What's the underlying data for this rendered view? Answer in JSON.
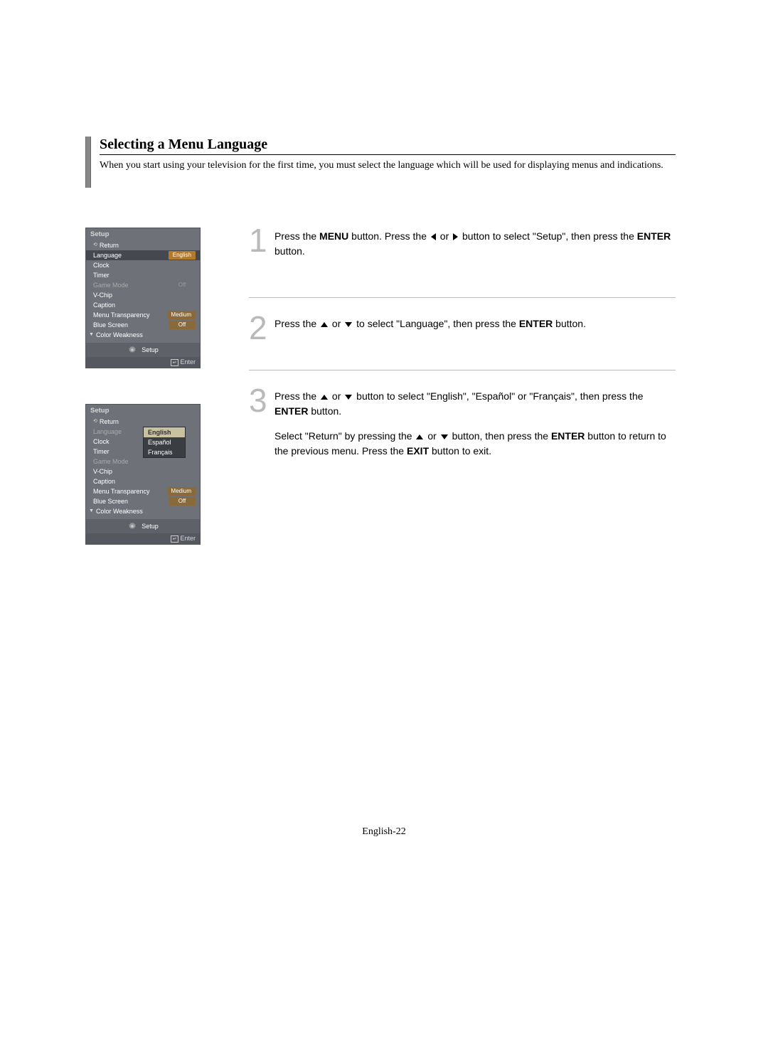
{
  "title": "Selecting a Menu Language",
  "intro": "When you start using your television for the first time, you must select the language which will be used for displaying menus and indications.",
  "panel1": {
    "title": "Setup",
    "return": "Return",
    "rows": {
      "language": {
        "label": "Language",
        "value": "English"
      },
      "clock": {
        "label": "Clock"
      },
      "timer": {
        "label": "Timer"
      },
      "game": {
        "label": "Game Mode",
        "value": "Off"
      },
      "vchip": {
        "label": "V-Chip"
      },
      "caption": {
        "label": "Caption"
      },
      "transparency": {
        "label": "Menu Transparency",
        "value": "Medium"
      },
      "bluescreen": {
        "label": "Blue Screen",
        "value": "Off"
      },
      "colorweak": {
        "label": "Color Weakness"
      }
    },
    "footer": "Setup",
    "enter": "Enter"
  },
  "panel2": {
    "title": "Setup",
    "return": "Return",
    "rows": {
      "language": {
        "label": "Language"
      },
      "clock": {
        "label": "Clock"
      },
      "timer": {
        "label": "Timer"
      },
      "game": {
        "label": "Game Mode"
      },
      "vchip": {
        "label": "V-Chip"
      },
      "caption": {
        "label": "Caption"
      },
      "transparency": {
        "label": "Menu Transparency",
        "value": "Medium"
      },
      "bluescreen": {
        "label": "Blue Screen",
        "value": "Off"
      },
      "colorweak": {
        "label": "Color Weakness"
      }
    },
    "dropdown": {
      "english": "English",
      "espanol": "Español",
      "francais": "Français"
    },
    "footer": "Setup",
    "enter": "Enter"
  },
  "steps": {
    "s1": {
      "num": "1",
      "t1": "Press the ",
      "b1": "MENU",
      "t2": " button. Press the ",
      "t3": " or ",
      "t4": " button to select \"Setup\", then press the ",
      "b2": "ENTER",
      "t5": " button."
    },
    "s2": {
      "num": "2",
      "t1": "Press the ",
      "t2": " or ",
      "t3": " to select \"Language\", then press the ",
      "b1": "ENTER",
      "t4": " button."
    },
    "s3": {
      "num": "3",
      "p1": {
        "t1": "Press the ",
        "t2": " or ",
        "t3": " button to select \"English\", \"Español\" or \"Français\", then press the ",
        "b1": "ENTER",
        "t4": " button."
      },
      "p2": {
        "t1": "Select \"Return\" by pressing the ",
        "t2": " or ",
        "t3": " button, then press the ",
        "b1": "ENTER",
        "t4": " button to return to the previous menu. Press the ",
        "b2": "EXIT",
        "t5": " button to exit."
      }
    }
  },
  "page_number": "English-22"
}
